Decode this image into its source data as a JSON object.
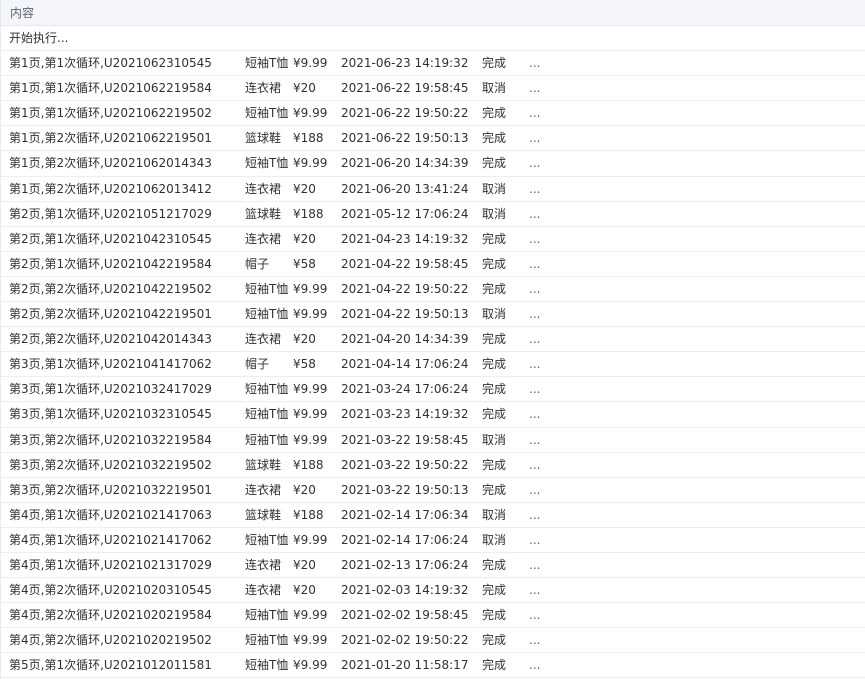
{
  "header": {
    "title": "内容"
  },
  "start_text": "开始执行...",
  "more_label": "...",
  "rows": [
    {
      "id": "第1页,第1次循环,U2021062310545",
      "product": "短袖T恤",
      "price": "¥9.99",
      "time": "2021-06-23 14:19:32",
      "status": "完成"
    },
    {
      "id": "第1页,第1次循环,U2021062219584",
      "product": "连衣裙",
      "price": "¥20",
      "time": "2021-06-22 19:58:45",
      "status": "取消"
    },
    {
      "id": "第1页,第1次循环,U2021062219502",
      "product": "短袖T恤",
      "price": "¥9.99",
      "time": "2021-06-22 19:50:22",
      "status": "完成"
    },
    {
      "id": "第1页,第2次循环,U2021062219501",
      "product": "篮球鞋",
      "price": "¥188",
      "time": "2021-06-22 19:50:13",
      "status": "完成"
    },
    {
      "id": "第1页,第2次循环,U2021062014343",
      "product": "短袖T恤",
      "price": "¥9.99",
      "time": "2021-06-20 14:34:39",
      "status": "完成"
    },
    {
      "id": "第1页,第2次循环,U2021062013412",
      "product": "连衣裙",
      "price": "¥20",
      "time": "2021-06-20 13:41:24",
      "status": "取消"
    },
    {
      "id": "第2页,第1次循环,U2021051217029",
      "product": "篮球鞋",
      "price": "¥188",
      "time": "2021-05-12 17:06:24",
      "status": "取消"
    },
    {
      "id": "第2页,第1次循环,U2021042310545",
      "product": "连衣裙",
      "price": "¥20",
      "time": "2021-04-23 14:19:32",
      "status": "完成"
    },
    {
      "id": "第2页,第1次循环,U2021042219584",
      "product": "帽子",
      "price": "¥58",
      "time": "2021-04-22 19:58:45",
      "status": "完成"
    },
    {
      "id": "第2页,第2次循环,U2021042219502",
      "product": "短袖T恤",
      "price": "¥9.99",
      "time": "2021-04-22 19:50:22",
      "status": "完成"
    },
    {
      "id": "第2页,第2次循环,U2021042219501",
      "product": "短袖T恤",
      "price": "¥9.99",
      "time": "2021-04-22 19:50:13",
      "status": "取消"
    },
    {
      "id": "第2页,第2次循环,U2021042014343",
      "product": "连衣裙",
      "price": "¥20",
      "time": "2021-04-20 14:34:39",
      "status": "完成"
    },
    {
      "id": "第3页,第1次循环,U2021041417062",
      "product": "帽子",
      "price": "¥58",
      "time": "2021-04-14 17:06:24",
      "status": "完成"
    },
    {
      "id": "第3页,第1次循环,U2021032417029",
      "product": "短袖T恤",
      "price": "¥9.99",
      "time": "2021-03-24 17:06:24",
      "status": "完成"
    },
    {
      "id": "第3页,第1次循环,U2021032310545",
      "product": "短袖T恤",
      "price": "¥9.99",
      "time": "2021-03-23 14:19:32",
      "status": "完成"
    },
    {
      "id": "第3页,第2次循环,U2021032219584",
      "product": "短袖T恤",
      "price": "¥9.99",
      "time": "2021-03-22 19:58:45",
      "status": "取消"
    },
    {
      "id": "第3页,第2次循环,U2021032219502",
      "product": "篮球鞋",
      "price": "¥188",
      "time": "2021-03-22 19:50:22",
      "status": "完成"
    },
    {
      "id": "第3页,第2次循环,U2021032219501",
      "product": "连衣裙",
      "price": "¥20",
      "time": "2021-03-22 19:50:13",
      "status": "完成"
    },
    {
      "id": "第4页,第1次循环,U2021021417063",
      "product": "篮球鞋",
      "price": "¥188",
      "time": "2021-02-14 17:06:34",
      "status": "取消"
    },
    {
      "id": "第4页,第1次循环,U2021021417062",
      "product": "短袖T恤",
      "price": "¥9.99",
      "time": "2021-02-14 17:06:24",
      "status": "取消"
    },
    {
      "id": "第4页,第1次循环,U2021021317029",
      "product": "连衣裙",
      "price": "¥20",
      "time": "2021-02-13 17:06:24",
      "status": "完成"
    },
    {
      "id": "第4页,第2次循环,U2021020310545",
      "product": "连衣裙",
      "price": "¥20",
      "time": "2021-02-03 14:19:32",
      "status": "完成"
    },
    {
      "id": "第4页,第2次循环,U2021020219584",
      "product": "短袖T恤",
      "price": "¥9.99",
      "time": "2021-02-02 19:58:45",
      "status": "完成"
    },
    {
      "id": "第4页,第2次循环,U2021020219502",
      "product": "短袖T恤",
      "price": "¥9.99",
      "time": "2021-02-02 19:50:22",
      "status": "完成"
    },
    {
      "id": "第5页,第1次循环,U2021012011581",
      "product": "短袖T恤",
      "price": "¥9.99",
      "time": "2021-01-20 11:58:17",
      "status": "完成"
    }
  ]
}
